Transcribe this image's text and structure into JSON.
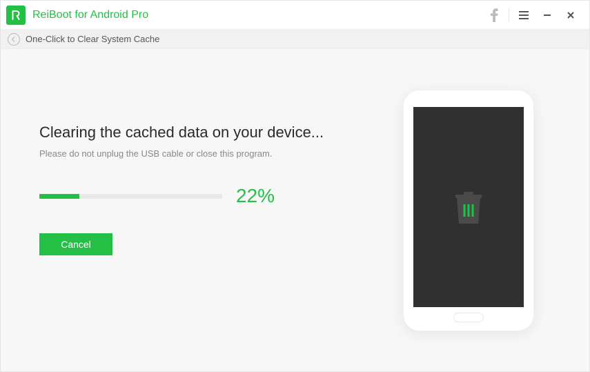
{
  "titlebar": {
    "app_name": "ReiBoot for Android Pro"
  },
  "breadcrumb": {
    "text": "One-Click to Clear System Cache"
  },
  "main": {
    "heading": "Clearing the cached data on your device...",
    "subtext": "Please do not unplug the USB cable or close this program.",
    "progress_percent": 22,
    "progress_label": "22%",
    "cancel_label": "Cancel"
  },
  "colors": {
    "accent": "#24c046"
  }
}
